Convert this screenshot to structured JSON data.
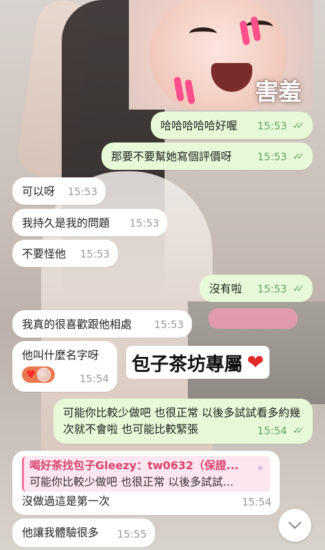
{
  "sticker": {
    "caption": "害羞"
  },
  "messages": [
    {
      "dir": "out",
      "text": "哈哈哈哈哈好喔",
      "time": "15:53",
      "read": true
    },
    {
      "dir": "out",
      "text": "那要不要幫她寫個評價呀",
      "time": "15:53",
      "read": true
    },
    {
      "dir": "in",
      "text": "可以呀",
      "time": "15:53"
    },
    {
      "dir": "in",
      "text": "我持久是我的問題",
      "time": "15:53"
    },
    {
      "dir": "in",
      "text": "不要怪他",
      "time": "15:53"
    },
    {
      "dir": "out",
      "text": "沒有啦",
      "time": "15:53",
      "read": true
    },
    {
      "dir": "in",
      "text": "我真的很喜歡跟他相處",
      "time": "15:53"
    },
    {
      "dir": "in",
      "text": "他叫什麼名字呀",
      "time": "15:54"
    },
    {
      "dir": "out",
      "text": "可能你比較少做吧 也很正常 以後多試試看多約幾次就不會啦 也可能比較緊張",
      "time": "15:54",
      "read": true
    },
    {
      "dir": "in",
      "quote": {
        "name": "喝好茶找包子Gleezy：tw0632（保證...",
        "text": "可能你比較少做吧 也很正常 以後多試試..."
      },
      "text": "沒做過這是第一次",
      "time": "15:54"
    },
    {
      "dir": "in",
      "text": "他讓我體驗很多",
      "time": "15:55"
    }
  ],
  "overlay": {
    "label": "包子茶坊專屬",
    "icon": "heart-icon"
  },
  "colors": {
    "outgoing": "#e7f9d8",
    "incoming": "#ffffff",
    "time_out": "#6aa56a",
    "quote_accent": "#ff6f9c"
  },
  "icons": {
    "read": "double-check-icon",
    "scroll": "chevron-down-icon"
  }
}
